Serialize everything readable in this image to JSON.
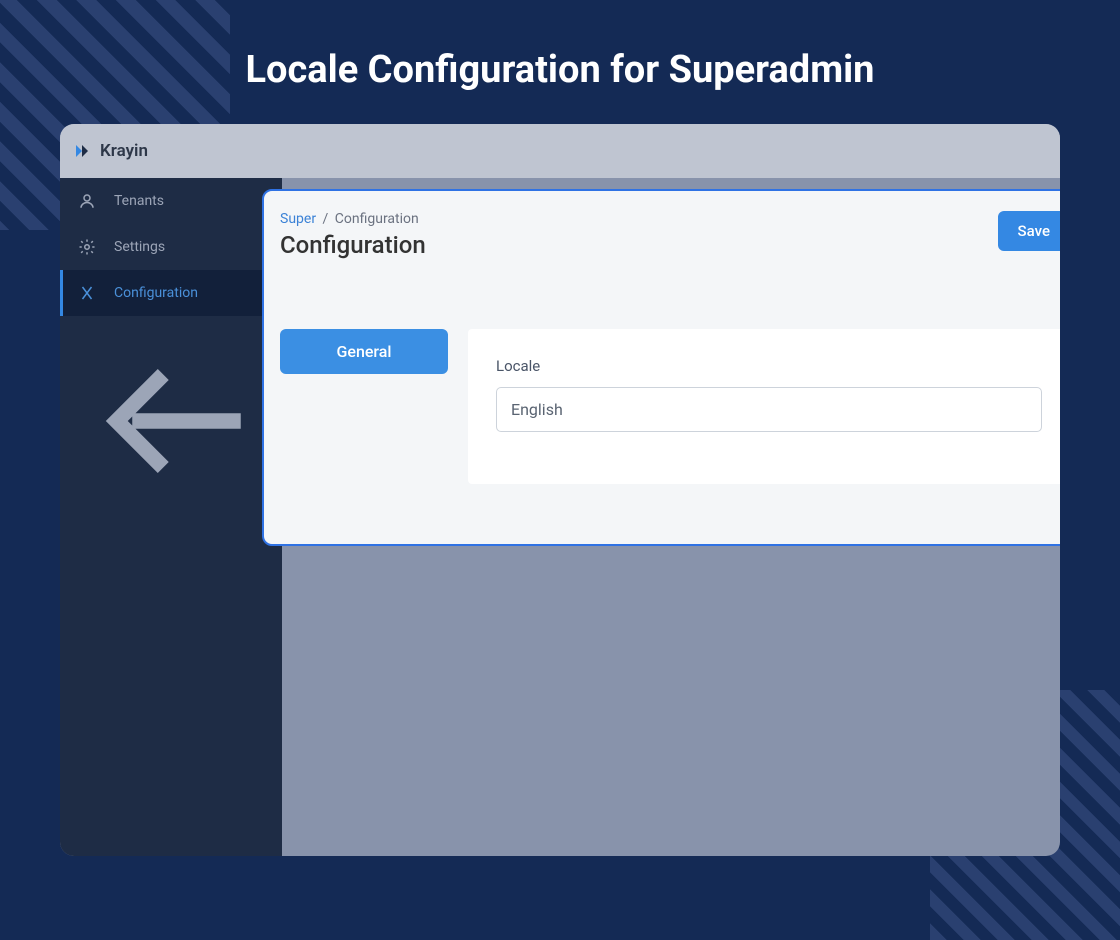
{
  "hero": {
    "title": "Locale Configuration for Superadmin"
  },
  "logo": {
    "text": "Krayin"
  },
  "sidebar": {
    "items": [
      {
        "label": "Tenants",
        "icon": "user-icon"
      },
      {
        "label": "Settings",
        "icon": "gear-icon"
      },
      {
        "label": "Configuration",
        "icon": "tools-icon"
      }
    ]
  },
  "breadcrumb": {
    "link": "Super",
    "current": "Configuration"
  },
  "panel": {
    "title": "Configuration",
    "save_label": "Save"
  },
  "tabs": {
    "general": "General"
  },
  "form": {
    "locale_label": "Locale",
    "locale_value": "English"
  }
}
